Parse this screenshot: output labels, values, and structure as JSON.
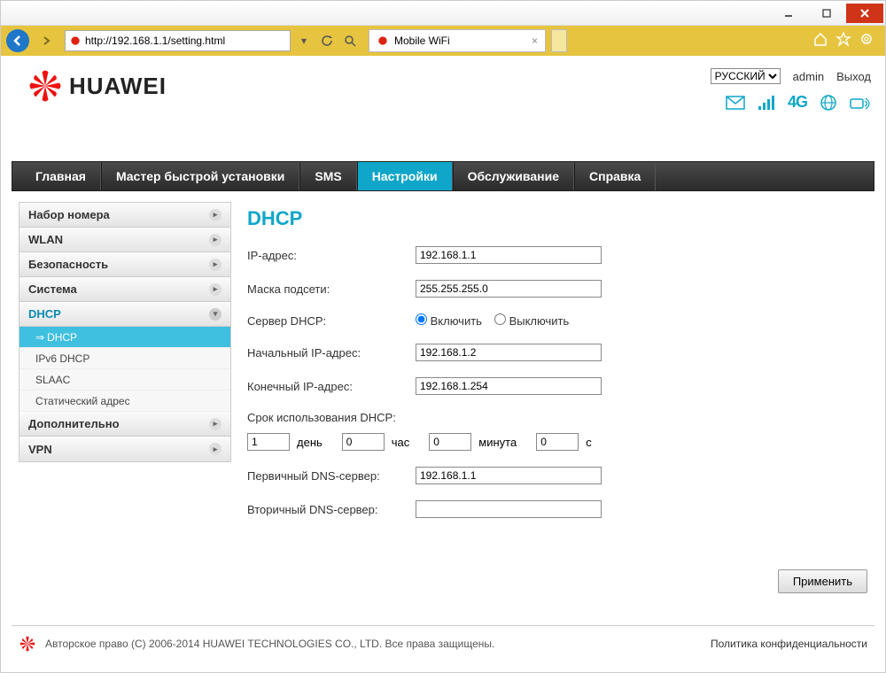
{
  "browser": {
    "url": "http://192.168.1.1/setting.html",
    "tab_title": "Mobile WiFi"
  },
  "header": {
    "language_options": [
      "РУССКИЙ"
    ],
    "language_selected": "РУССКИЙ",
    "admin_label": "admin",
    "logout_label": "Выход",
    "network_label": "4G",
    "brand": "HUAWEI"
  },
  "menubar": {
    "items": [
      "Главная",
      "Мастер быстрой установки",
      "SMS",
      "Настройки",
      "Обслуживание",
      "Справка"
    ],
    "active_index": 3
  },
  "sidebar": {
    "groups": [
      {
        "label": "Набор номера",
        "open": false
      },
      {
        "label": "WLAN",
        "open": false
      },
      {
        "label": "Безопасность",
        "open": false
      },
      {
        "label": "Система",
        "open": false
      },
      {
        "label": "DHCP",
        "open": true,
        "items": [
          "DHCP",
          "IPv6 DHCP",
          "SLAAC",
          "Статический адрес"
        ],
        "active_sub": 0
      },
      {
        "label": "Дополнительно",
        "open": false
      },
      {
        "label": "VPN",
        "open": false
      }
    ]
  },
  "page": {
    "title": "DHCP",
    "labels": {
      "ip": "IP-адрес:",
      "mask": "Маска подсети:",
      "server": "Сервер DHCP:",
      "enable": "Включить",
      "disable": "Выключить",
      "start_ip": "Начальный IP-адрес:",
      "end_ip": "Конечный IP-адрес:",
      "lease": "Срок использования DHCP:",
      "day": "день",
      "hour": "час",
      "minute": "минута",
      "second": "с",
      "dns1": "Первичный DNS-сервер:",
      "dns2": "Вторичный DNS-сервер:",
      "apply": "Применить"
    },
    "values": {
      "ip": "192.168.1.1",
      "mask": "255.255.255.0",
      "server_enabled": true,
      "start_ip": "192.168.1.2",
      "end_ip": "192.168.1.254",
      "lease_day": "1",
      "lease_hour": "0",
      "lease_minute": "0",
      "lease_second": "0",
      "dns1": "192.168.1.1",
      "dns2": ""
    }
  },
  "footer": {
    "copyright": "Авторское право (C) 2006-2014 HUAWEI TECHNOLOGIES CO., LTD. Все права защищены.",
    "privacy": "Политика конфиденциальности"
  }
}
